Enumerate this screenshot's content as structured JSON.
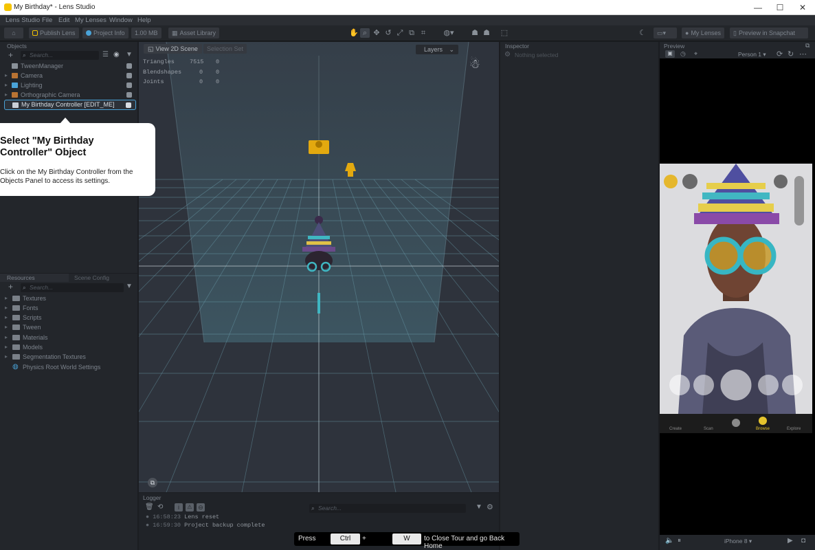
{
  "window": {
    "title": "My Birthday* - Lens Studio",
    "minimize": "—",
    "maximize": "☐",
    "close": "✕"
  },
  "menu": [
    "Lens Studio",
    "File",
    "Edit",
    "My Lenses",
    "Window",
    "Help"
  ],
  "toolbar": {
    "publish_label": "Publish Lens",
    "project_info_label": "Project Info",
    "size_label": "1.00 MB",
    "asset_library_label": "Asset Library",
    "my_lenses_label": "My Lenses",
    "preview_snapchat_label": "Preview in Snapchat"
  },
  "objects_panel": {
    "title": "Objects",
    "search_placeholder": "Search...",
    "items": [
      {
        "label": "TweenManager",
        "icon_color": "#8a9199"
      },
      {
        "label": "Camera",
        "icon_color": "#b87333"
      },
      {
        "label": "Lighting",
        "icon_color": "#4aa3d8"
      },
      {
        "label": "Orthographic Camera",
        "icon_color": "#b87333"
      },
      {
        "label": "My Birthday Controller [EDIT_ME]",
        "icon_color": "#c9cfd6"
      }
    ]
  },
  "resources_panel": {
    "tab_resources": "Resources",
    "tab_scene_config": "Scene Config",
    "search_placeholder": "Search...",
    "items": [
      "Textures",
      "Fonts",
      "Scripts",
      "Tween",
      "Materials",
      "Models",
      "Segmentation Textures"
    ],
    "physics_item": "Physics Root World Settings"
  },
  "scene": {
    "view_label": "View 2D Scene",
    "selection_set_label": "Selection Set",
    "layers_label": "Layers",
    "stats": [
      {
        "name": "Triangles",
        "a": "7515",
        "b": "0"
      },
      {
        "name": "Blendshapes",
        "a": "0",
        "b": "0"
      },
      {
        "name": "Joints",
        "a": "0",
        "b": "0"
      }
    ]
  },
  "logger": {
    "title": "Logger",
    "search_placeholder": "Search...",
    "lines": [
      {
        "time": "16:58:23",
        "message": "Lens reset"
      },
      {
        "time": "16:59:30",
        "message": "Project backup complete"
      }
    ]
  },
  "inspector": {
    "title": "Inspector",
    "empty_text": "Nothing selected"
  },
  "preview": {
    "title": "Preview",
    "person_select": "Person 1",
    "device_select": "iPhone 8",
    "nav_labels": [
      "Create",
      "Scan",
      "Browse",
      "Explore"
    ]
  },
  "tour": {
    "title": "Select \"My Birthday Controller\" Object",
    "body": "Click on the My Birthday Controller from the Objects Panel to access its settings."
  },
  "key_hint": {
    "press": "Press",
    "ctrl": "Ctrl",
    "plus": "+",
    "w": "W",
    "suffix": "to Close Tour and go Back Home"
  },
  "colors": {
    "accent_yellow": "#f5c400",
    "selection_blue": "#4aa3d8",
    "panel_bg": "#23262b",
    "scene_bg": "#2e333c"
  }
}
